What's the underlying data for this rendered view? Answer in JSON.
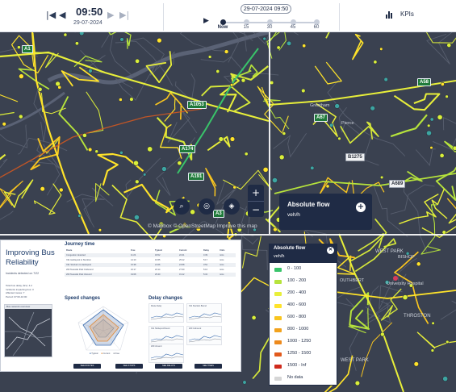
{
  "header": {
    "time": "09:50",
    "date": "29-07-2024",
    "timeline_date": "29-07-2024 09:50",
    "timeline_ticks": [
      "Now",
      "15",
      "30",
      "45",
      "60"
    ],
    "timeline_active_index": 0,
    "kpis_label": "KPIs",
    "icons": {
      "first": "skip-to-start-icon",
      "prev": "step-back-icon",
      "next": "step-forward-icon",
      "last": "skip-to-end-icon",
      "play": "play-icon",
      "kpi": "bar-chart-icon"
    }
  },
  "map": {
    "road_labels": {
      "a193": "A1",
      "a1058": "A58",
      "a1054": "A1053",
      "a174": "A174",
      "a1191": "A191",
      "a173": "A3",
      "a68": "A68",
      "a67": "A67",
      "b1275": "B1275",
      "a689": "A689"
    },
    "attribution": "© Mapbox © OpenStreetMap  Improve this map",
    "controls": {
      "search_icon": "search-icon",
      "radar_icon": "radar-icon",
      "layers_icon": "layers-icon",
      "zoom_in": "+",
      "zoom_out": "−"
    },
    "flow_card": {
      "title": "Absolute flow",
      "unit": "veh/h",
      "button": "+"
    },
    "place_labels": {
      "west_park": "WEST PARK",
      "bishop": "BISHOP",
      "university_hospital": "University Hospital",
      "throston": "THROSTON",
      "outhbert": "OUTHBERT",
      "west_park2": "WEST PARK",
      "greatham": "Greatham",
      "pierce": "Pierce"
    }
  },
  "legend": {
    "title": "Absolute flow",
    "unit": "veh/h",
    "close": "✕",
    "items": [
      {
        "label": "0 - 100",
        "color": "#39c46a"
      },
      {
        "label": "100 - 200",
        "color": "#b6e33c"
      },
      {
        "label": "200 - 400",
        "color": "#e8ef3a"
      },
      {
        "label": "400 - 600",
        "color": "#ffe32a"
      },
      {
        "label": "600 - 800",
        "color": "#f9c51f"
      },
      {
        "label": "800 - 1000",
        "color": "#f2a21c"
      },
      {
        "label": "1000 - 1250",
        "color": "#ed8a1d"
      },
      {
        "label": "1250 - 1500",
        "color": "#e25a1c"
      },
      {
        "label": "1500 - Inf",
        "color": "#cf2a1c"
      },
      {
        "label": "No data",
        "color": "#d6d6d6"
      }
    ]
  },
  "report": {
    "title": "Improving Bus Reliability",
    "subtitle": "Incidents detected on 7/22",
    "facts": [
      "Total bus delay (hrs): 4.2",
      "Incidents impacting bus: 3",
      "Affected routes: 7",
      "Period: 07:00-10:00"
    ],
    "map_caption": "Bus network overview",
    "journey_time_title": "Journey time",
    "journey_header": [
      "Route",
      "Free",
      "Typical",
      "Current",
      "Delay",
      "Units"
    ],
    "journey_rows": [
      [
        "Congestion detected",
        "11:24",
        "18:02",
        "22:41",
        "4:39",
        "mins"
      ],
      [
        "X21 Hartlepool to Stockton",
        "14:10",
        "19:55",
        "25:12",
        "5:17",
        "mins"
      ],
      [
        "X21 Stockton to Hartlepool",
        "15:38",
        "21:06",
        "24:58",
        "3:52",
        "mins"
      ],
      [
        "263 Teesside Park Outbound",
        "16:17",
        "22:14",
        "27:30",
        "5:16",
        "mins"
      ],
      [
        "263 Teesside Park Inbound",
        "19:08",
        "25:40",
        "31:12",
        "5:32",
        "mins"
      ]
    ],
    "speed_changes_title": "Speed changes",
    "delay_changes_title": "Delay changes",
    "delay_charts": [
      "Route Delay",
      "X21 Stockton Bound",
      "X21 Hartlepool Bound",
      "263 Outbound",
      "263 Inbound"
    ],
    "radar_legend": [
      "Typical",
      "Current",
      "Free"
    ],
    "buttons": [
      "SEE ROUTES",
      "SEE STOPS",
      "SEE DELAYS",
      "SEE TIMES"
    ]
  }
}
